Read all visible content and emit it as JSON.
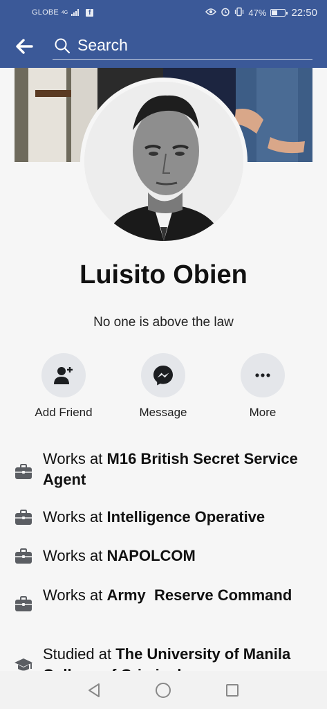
{
  "status_bar": {
    "carrier": "GLOBE",
    "network": "4G",
    "battery_percent": "47%",
    "battery_level": 0.47,
    "time": "22:50",
    "icons": [
      "signal-icon",
      "facebook-notification-icon",
      "eye-icon",
      "alarm-icon",
      "vibrate-icon",
      "battery-icon"
    ]
  },
  "app_bar": {
    "search_placeholder": "Search",
    "back_icon": "arrow-left-icon",
    "search_icon": "search-icon"
  },
  "profile": {
    "name": "Luisito Obien",
    "bio": "No one is above the law"
  },
  "actions": [
    {
      "label": "Add Friend",
      "icon": "add-friend-icon"
    },
    {
      "label": "Message",
      "icon": "messenger-icon"
    },
    {
      "label": "More",
      "icon": "more-dots-icon"
    }
  ],
  "info": [
    {
      "prefix": "Works at ",
      "place": "M16 British Secret Service Agent",
      "icon": "briefcase-icon"
    },
    {
      "prefix": "Works at ",
      "place": "Intelligence Operative",
      "icon": "briefcase-icon"
    },
    {
      "prefix": "Works at ",
      "place": "NAPOLCOM",
      "icon": "briefcase-icon"
    },
    {
      "prefix": "Works at ",
      "place": "Army  Reserve Command",
      "icon": "briefcase-icon"
    },
    {
      "prefix": "Studied at ",
      "place": "The University of Manila College of Criminal",
      "icon": "graduation-cap-icon"
    }
  ],
  "colors": {
    "facebook_blue": "#3b5998",
    "action_circle": "#e4e6ea",
    "background": "#f6f6f6"
  }
}
